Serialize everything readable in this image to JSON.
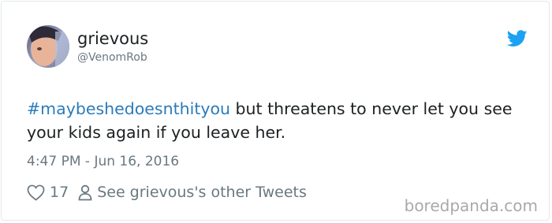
{
  "tweet": {
    "author_name": "grievous",
    "author_handle": "@VenomRob",
    "hashtag": "#maybeshedoesnthityou",
    "text_rest": " but threatens to never let you see your kids again if you leave her.",
    "timestamp": "4:47 PM - Jun 16, 2016",
    "like_count": "17",
    "see_other_label": "See grievous's other Tweets",
    "icons": {
      "brand": "twitter-bird-icon",
      "like": "heart-icon",
      "profile": "person-icon"
    },
    "colors": {
      "hashtag": "#2b7bb9",
      "bird": "#1da1f2",
      "meta": "#697882"
    }
  },
  "watermark": "boredpanda.com"
}
